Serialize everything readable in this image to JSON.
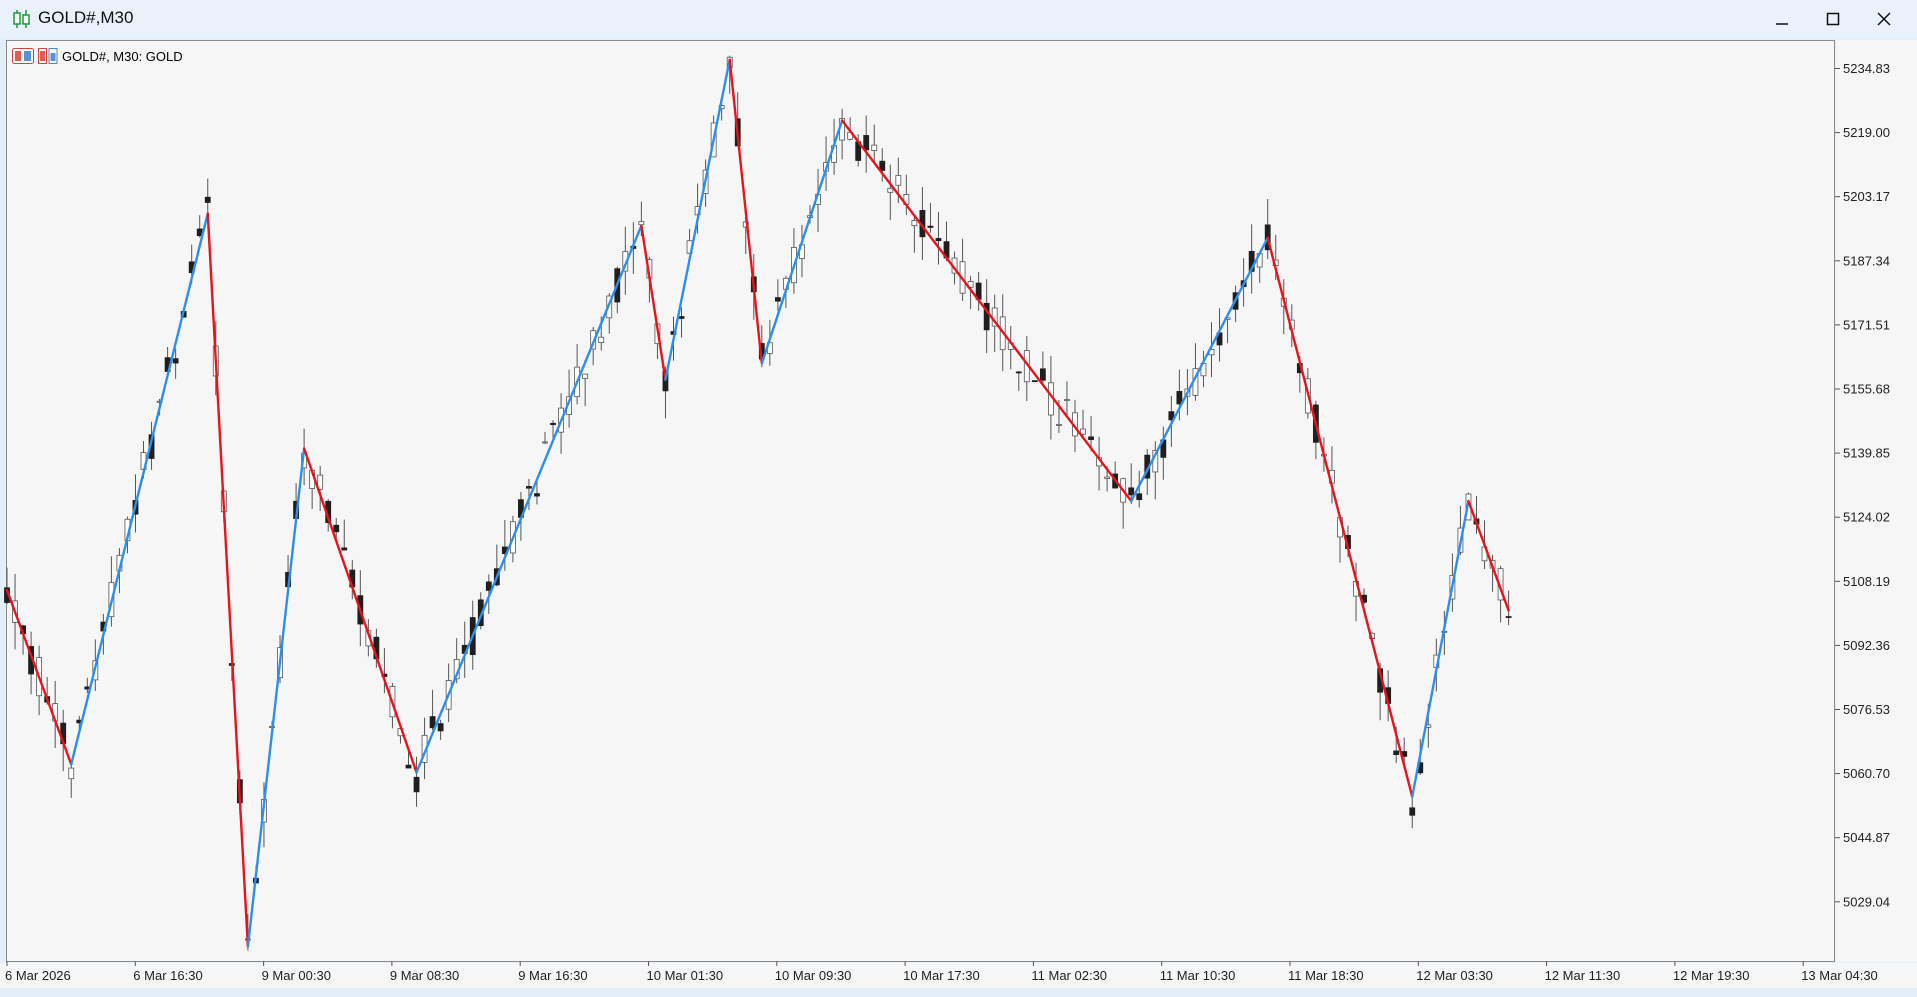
{
  "window": {
    "title": "GOLD#,M30",
    "controls": [
      "minimize-icon",
      "maximize-icon",
      "close-icon"
    ]
  },
  "chart_label": {
    "text": "GOLD#, M30:  GOLD",
    "icons": [
      "one-click-trading-icon",
      "depth-of-market-icon"
    ]
  },
  "colors": {
    "zigzag_up": "#2e8fe8",
    "zigzag_down": "#e8141b",
    "candle_bull": "#ffffff",
    "candle_bear": "#1f1f1f",
    "candle_outline": "#555555",
    "background": "#f6f6f6"
  },
  "chart_data": {
    "type": "candlestick",
    "symbol": "GOLD#",
    "timeframe": "M30",
    "y_ticks": [
      "5234.83",
      "5219.00",
      "5203.17",
      "5187.34",
      "5171.51",
      "5155.68",
      "5139.85",
      "5124.02",
      "5108.19",
      "5092.36",
      "5076.53",
      "5060.70",
      "5044.87",
      "5029.04"
    ],
    "ylim": [
      5017,
      5238
    ],
    "x_ticks": [
      "6 Mar 2026",
      "6 Mar 16:30",
      "9 Mar 00:30",
      "9 Mar 08:30",
      "9 Mar 16:30",
      "10 Mar 01:30",
      "10 Mar 09:30",
      "10 Mar 17:30",
      "11 Mar 02:30",
      "11 Mar 10:30",
      "11 Mar 18:30",
      "12 Mar 03:30",
      "12 Mar 11:30",
      "12 Mar 19:30",
      "13 Mar 04:30"
    ],
    "zigzag": [
      {
        "bar": 0,
        "price": 5106
      },
      {
        "bar": 8,
        "price": 5063
      },
      {
        "bar": 25,
        "price": 5199
      },
      {
        "bar": 30,
        "price": 5018
      },
      {
        "bar": 37,
        "price": 5141
      },
      {
        "bar": 51,
        "price": 5061
      },
      {
        "bar": 79,
        "price": 5196
      },
      {
        "bar": 82,
        "price": 5158
      },
      {
        "bar": 90,
        "price": 5237
      },
      {
        "bar": 94,
        "price": 5162
      },
      {
        "bar": 104,
        "price": 5222
      },
      {
        "bar": 140,
        "price": 5128
      },
      {
        "bar": 157,
        "price": 5193
      },
      {
        "bar": 175,
        "price": 5055
      },
      {
        "bar": 182,
        "price": 5128
      },
      {
        "bar": 187,
        "price": 5101
      }
    ]
  }
}
